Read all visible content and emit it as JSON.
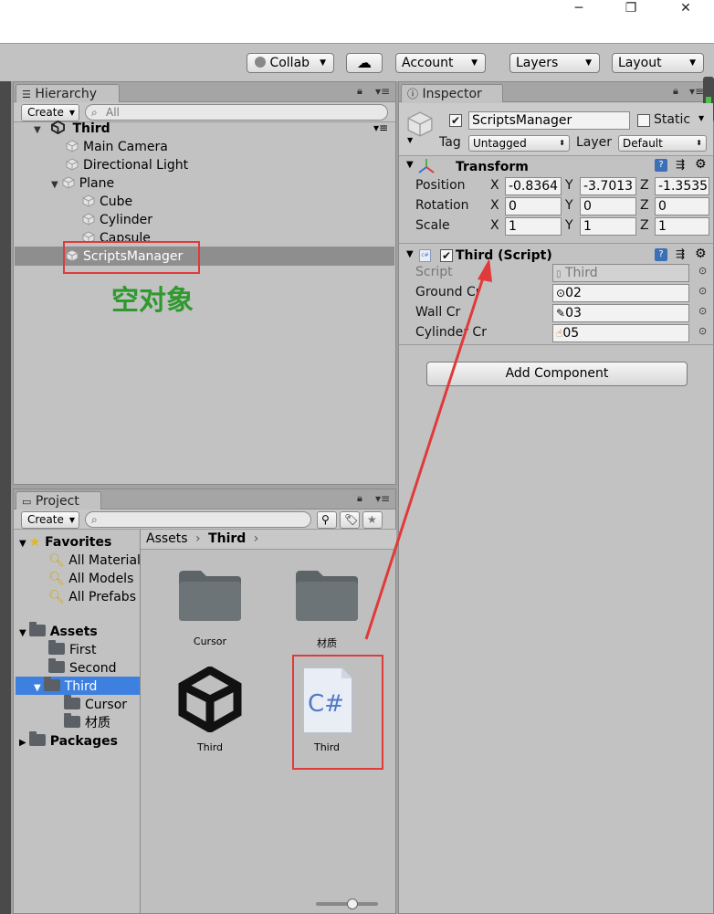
{
  "window": {
    "minimize": "─",
    "restore": "❐",
    "close": "✕"
  },
  "toolbar": {
    "collab": "Collab",
    "account": "Account",
    "layers": "Layers",
    "layout": "Layout"
  },
  "hierarchy": {
    "tab": "Hierarchy",
    "create": "Create",
    "search_placeholder": "All",
    "scene": "Third",
    "items": [
      "Main Camera",
      "Directional Light",
      "Plane",
      "Cube",
      "Cylinder",
      "Capsule",
      "ScriptsManager"
    ],
    "annotation": "空对象"
  },
  "inspector": {
    "tab": "Inspector",
    "object_name": "ScriptsManager",
    "static": "Static",
    "tag_label": "Tag",
    "tag_value": "Untagged",
    "layer_label": "Layer",
    "layer_value": "Default",
    "transform": {
      "title": "Transform",
      "position_label": "Position",
      "pos": [
        "-0.8364",
        "-3.7013",
        "-1.3535"
      ],
      "rotation_label": "Rotation",
      "rot": [
        "0",
        "0",
        "0"
      ],
      "scale_label": "Scale",
      "scl": [
        "1",
        "1",
        "1"
      ],
      "x": "X",
      "y": "Y",
      "z": "Z"
    },
    "script": {
      "title": "Third (Script)",
      "script_label": "Script",
      "script_value": "Third",
      "ground_label": "Ground Cr",
      "ground_value": "02",
      "wall_label": "Wall Cr",
      "wall_value": "03",
      "cylinder_label": "Cylinder Cr",
      "cylinder_value": "05"
    },
    "add_component": "Add Component"
  },
  "project": {
    "tab": "Project",
    "create": "Create",
    "favorites": "Favorites",
    "fav_items": [
      "All Materials",
      "All Models",
      "All Prefabs"
    ],
    "assets": "Assets",
    "asset_items": [
      "First",
      "Second",
      "Third"
    ],
    "third_children": [
      "Cursor",
      "材质"
    ],
    "packages": "Packages",
    "breadcrumb": [
      "Assets",
      "Third"
    ],
    "grid": [
      {
        "label": "Cursor"
      },
      {
        "label": "材质"
      },
      {
        "label": "Third"
      },
      {
        "label": "Third"
      }
    ],
    "csharp_text": "C#"
  },
  "colors": {
    "accent_selected": "#3d80df",
    "annotation_red": "#e03a3a",
    "annotation_green": "#2e9a2e"
  }
}
